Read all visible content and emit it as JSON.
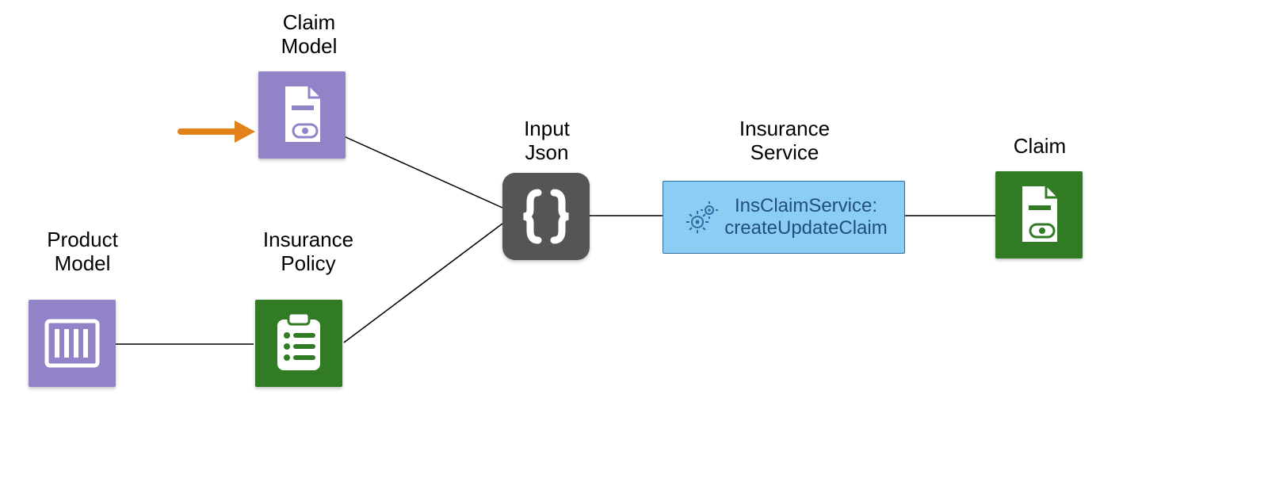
{
  "labels": {
    "claim_model": "Claim\nModel",
    "product_model": "Product\nModel",
    "insurance_policy": "Insurance\nPolicy",
    "input_json": "Input\nJson",
    "insurance_service": "Insurance\nService",
    "claim": "Claim"
  },
  "service": {
    "text": "InsClaimService:\ncreateUpdateClaim"
  },
  "colors": {
    "purple": "#9282c7",
    "green": "#327b25",
    "dark_gray": "#555555",
    "service_fill": "#8ccef3",
    "service_border": "#2b6ea3",
    "arrow": "#e1821a"
  },
  "icons": {
    "claim_model": "bill-document-icon",
    "product_model": "barcode-icon",
    "insurance_policy": "clipboard-list-icon",
    "input_json": "braces-icon",
    "claim": "bill-document-icon",
    "service_gears": "gears-icon"
  }
}
